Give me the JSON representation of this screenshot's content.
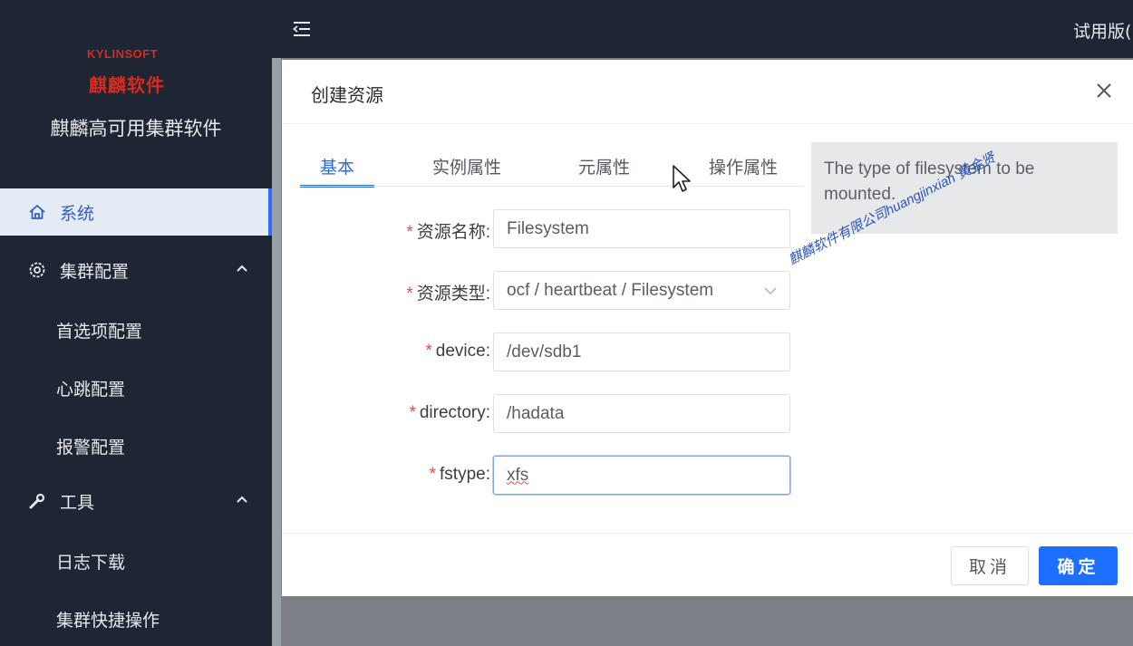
{
  "brand": {
    "logo_latin": "KYLINSOFT",
    "logo_cn": "麒麟软件",
    "app_name": "麒麟高可用集群软件"
  },
  "sidebar": {
    "items": [
      {
        "label": "系统",
        "icon": "home-icon",
        "active": true
      },
      {
        "label": "集群配置",
        "icon": "gear-icon",
        "expanded": true
      },
      {
        "label": "首选项配置"
      },
      {
        "label": "心跳配置"
      },
      {
        "label": "报警配置"
      },
      {
        "label": "工具",
        "icon": "wrench-icon",
        "expanded": true
      },
      {
        "label": "日志下载"
      },
      {
        "label": "集群快捷操作"
      }
    ]
  },
  "topbar": {
    "fold_icon": "menu-fold-icon",
    "trial_label": "试用版("
  },
  "dialog": {
    "title": "创建资源",
    "tabs": [
      {
        "label": "基本",
        "active": true
      },
      {
        "label": "实例属性"
      },
      {
        "label": "元属性"
      },
      {
        "label": "操作属性"
      }
    ],
    "help_text": "The type of filesystem to be mounted.",
    "fields": [
      {
        "label": "资源名称:",
        "value": "Filesystem",
        "required": true
      },
      {
        "label": "资源类型:",
        "value": "ocf / heartbeat / Filesystem",
        "required": true,
        "type": "select"
      },
      {
        "label": "device:",
        "value": "/dev/sdb1",
        "required": true
      },
      {
        "label": "directory:",
        "value": "/hadata",
        "required": true
      },
      {
        "label": "fstype:",
        "value": "xfs",
        "required": true,
        "focused": true
      }
    ],
    "cancel_label": "取消",
    "ok_label": "确定"
  },
  "watermark": "麒麟软件有限公司huangjinxian 黄金贤",
  "colors": {
    "sidebar_bg": "#1f2633",
    "primary": "#1e6fff",
    "brand_red": "#d42a1f",
    "required": "#e24d4d"
  }
}
